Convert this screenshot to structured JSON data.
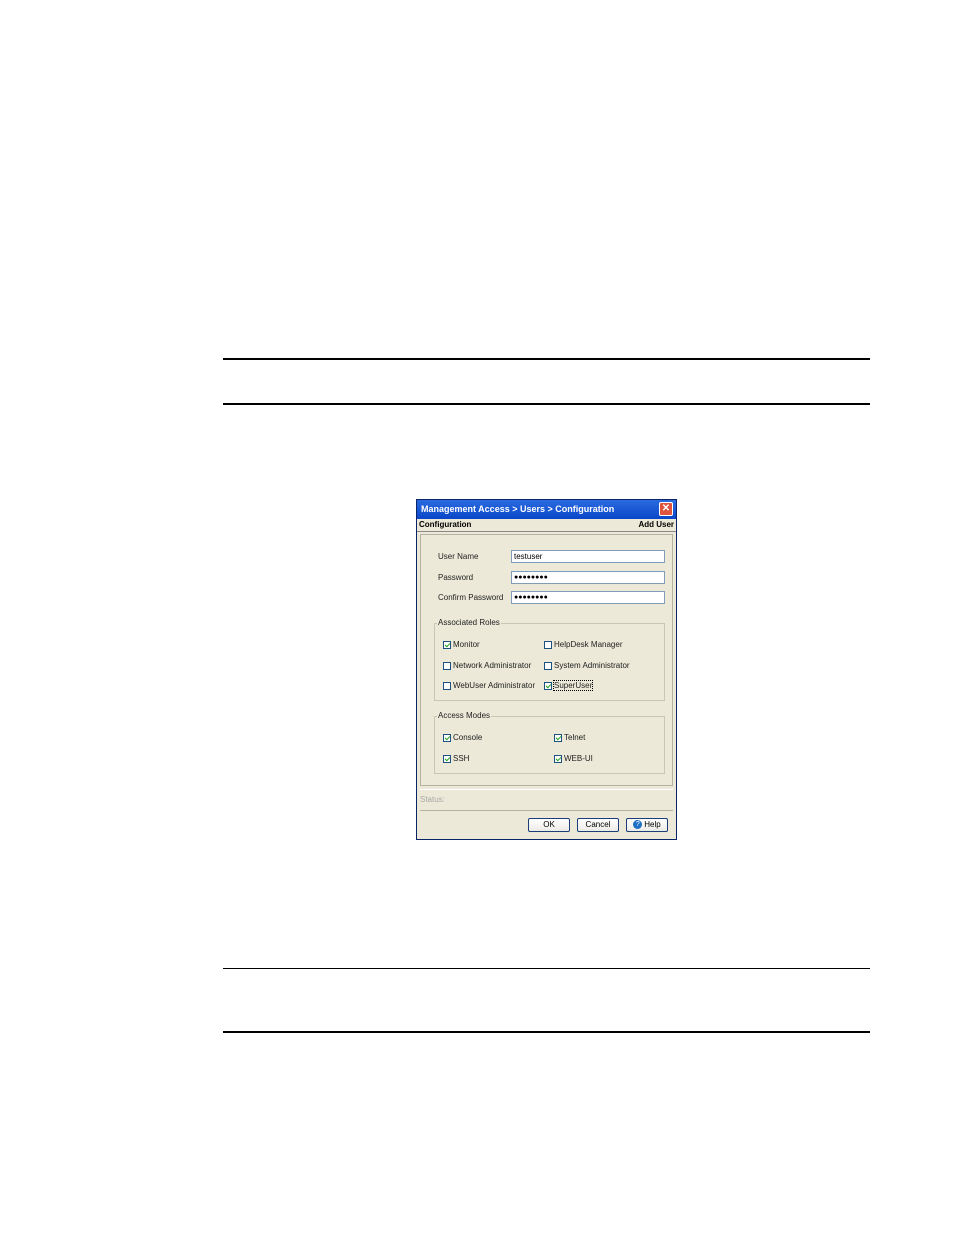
{
  "dialog": {
    "title": "Management Access > Users > Configuration",
    "close_glyph": "✕",
    "subheader_left": "Configuration",
    "subheader_right": "Add User",
    "fields": {
      "username_label": "User Name",
      "username_value": "testuser",
      "password_label": "Password",
      "password_value": "●●●●●●●●",
      "confirm_label": "Confirm Password",
      "confirm_value": "●●●●●●●●"
    },
    "roles": {
      "title": "Associated Roles",
      "items": [
        {
          "label": "Monitor",
          "checked": true
        },
        {
          "label": "HelpDesk Manager",
          "checked": false
        },
        {
          "label": "Network Administrator",
          "checked": false
        },
        {
          "label": "System Administrator",
          "checked": false
        },
        {
          "label": "WebUser Administrator",
          "checked": false
        },
        {
          "label": "SuperUser",
          "checked": true
        }
      ]
    },
    "modes": {
      "title": "Access Modes",
      "items": [
        {
          "label": "Console",
          "checked": true
        },
        {
          "label": "Telnet",
          "checked": true
        },
        {
          "label": "SSH",
          "checked": true
        },
        {
          "label": "WEB-UI",
          "checked": true
        }
      ]
    },
    "status_label": "Status:",
    "buttons": {
      "ok": "OK",
      "cancel": "Cancel",
      "help": "Help",
      "help_glyph": "?"
    }
  },
  "icons": [
    "close-icon",
    "help-icon",
    "checkbox-checked-icon",
    "checkbox-unchecked-icon"
  ],
  "colors": {
    "titlebar": "#0a46c8",
    "dialog_bg": "#ece9d8",
    "checkmark": "#21a121"
  }
}
